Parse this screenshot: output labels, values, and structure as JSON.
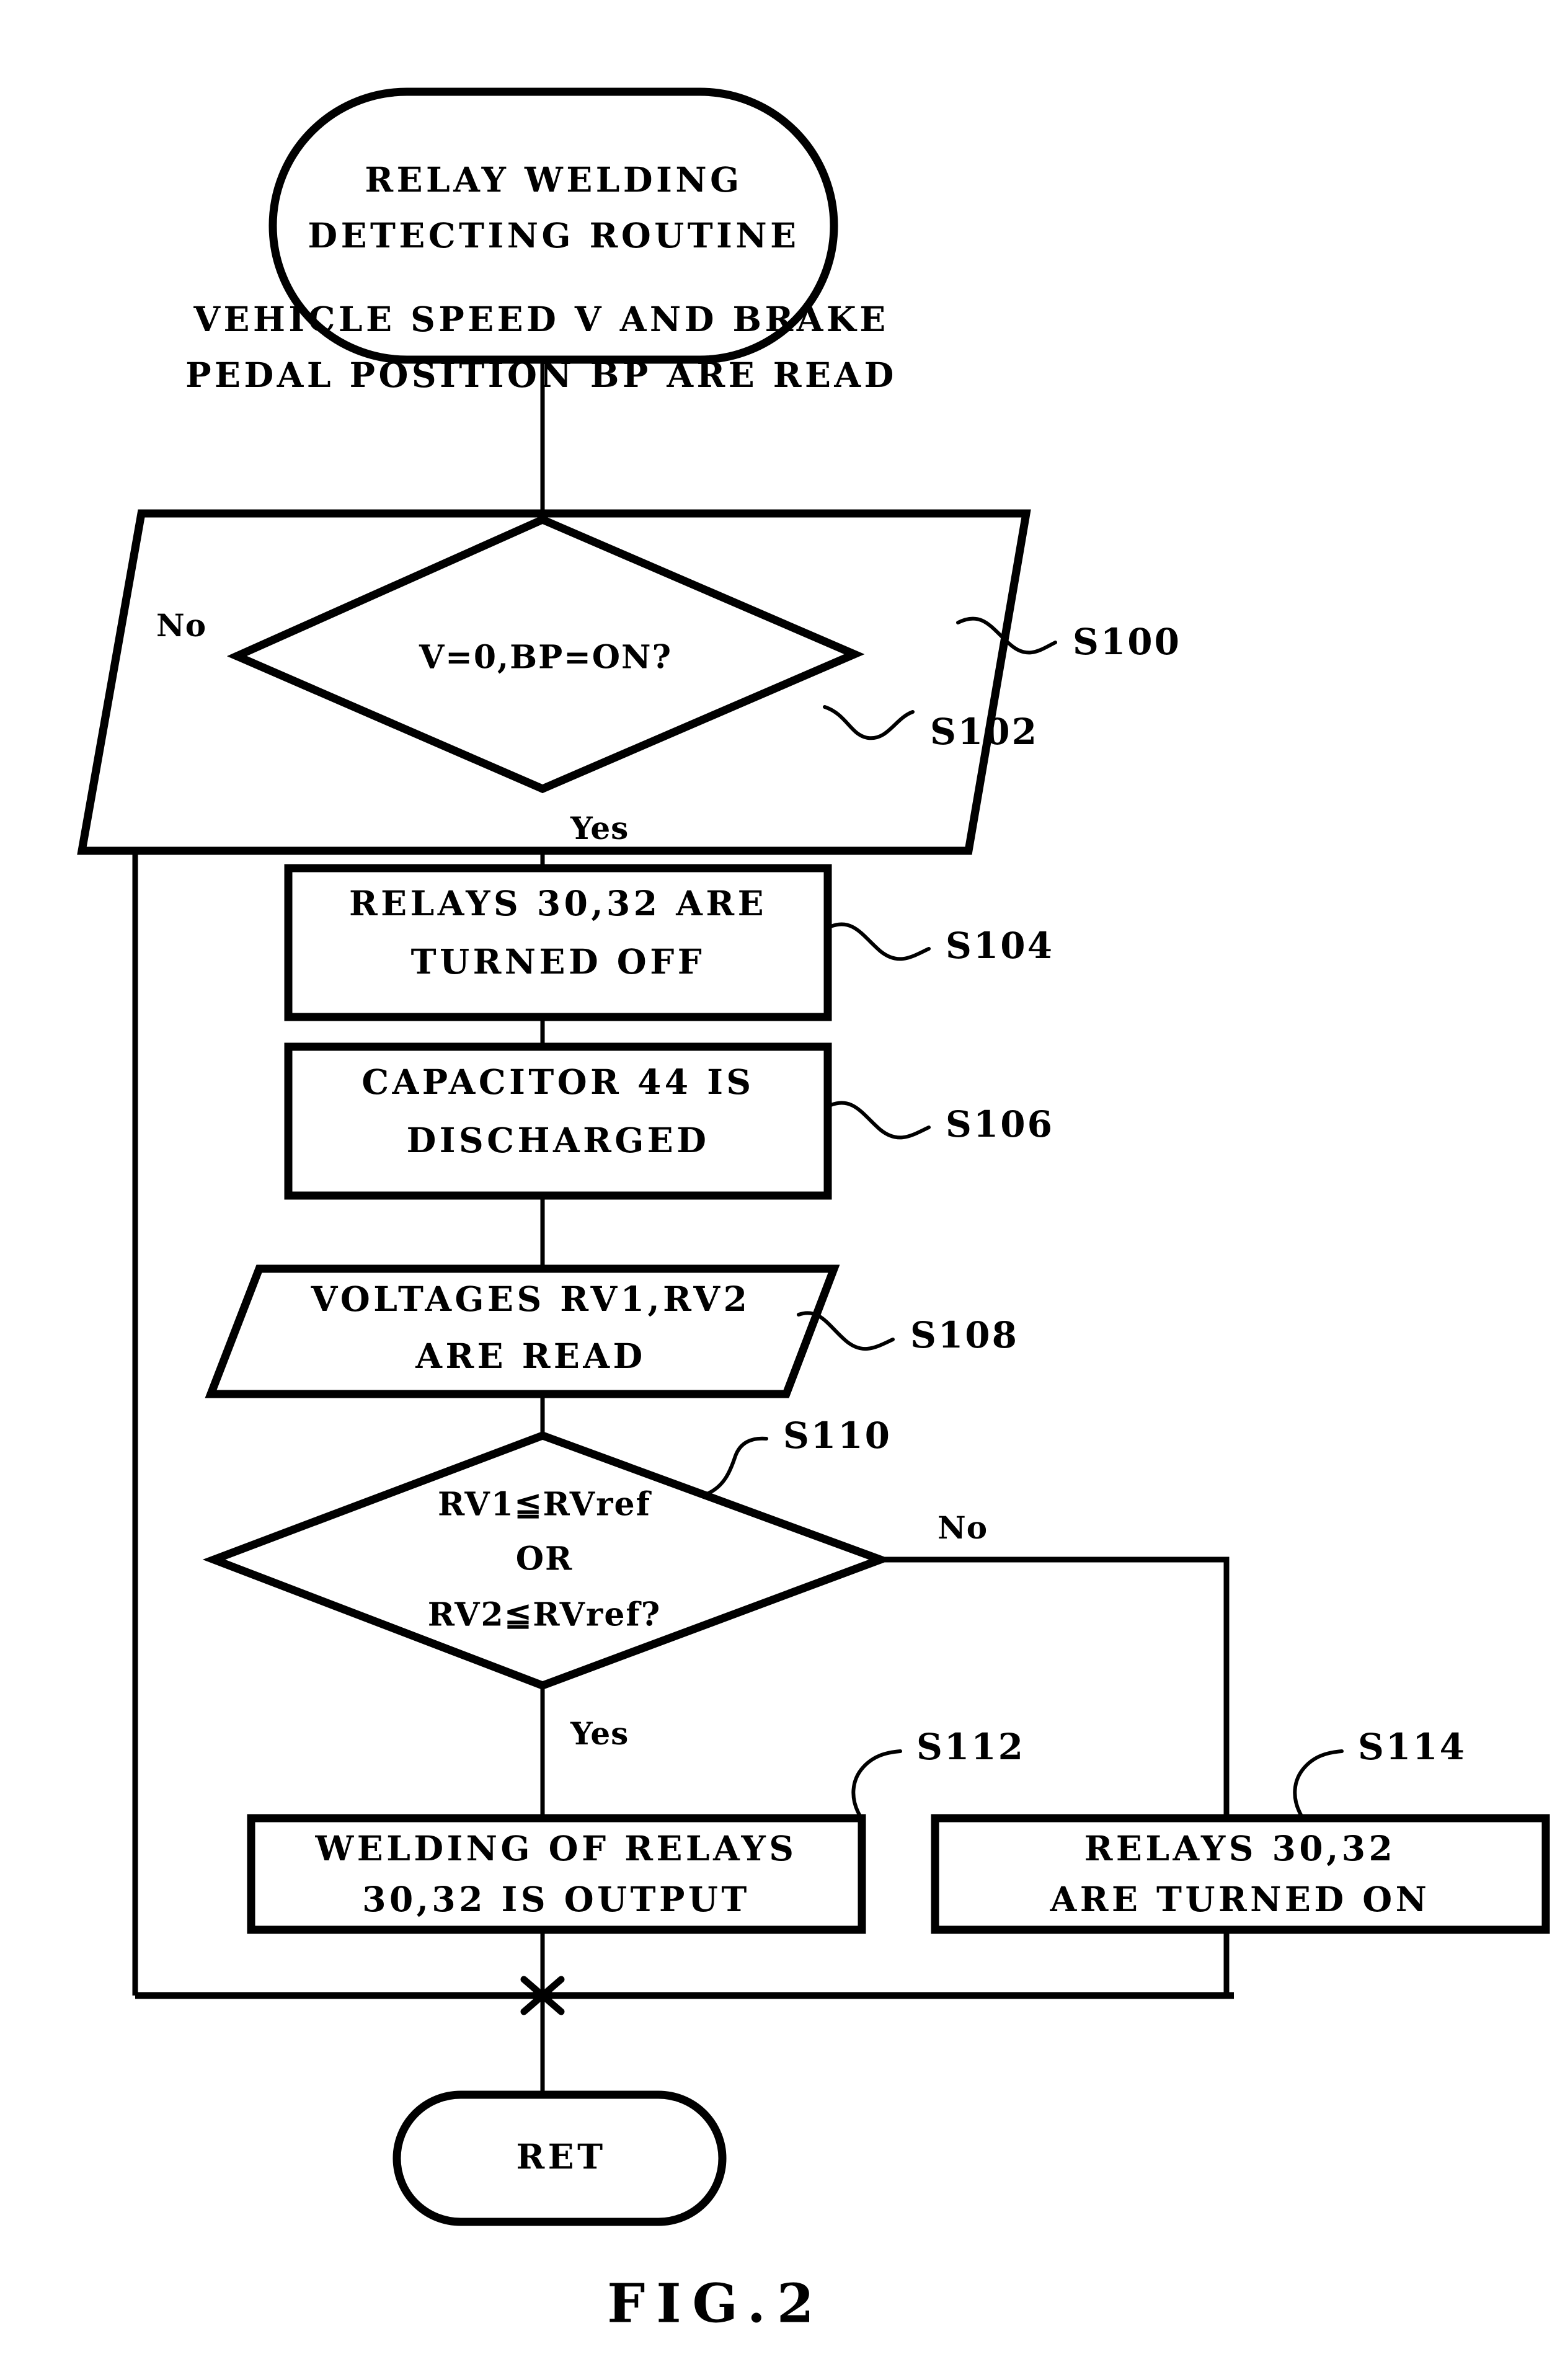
{
  "figure": {
    "caption": "FIG.2",
    "title": "RELAY WELDING DETECTING ROUTINE"
  },
  "nodes": {
    "start": {
      "kind": "terminator",
      "line1": "RELAY WELDING",
      "line2": "DETECTING ROUTINE"
    },
    "s100": {
      "kind": "input-output",
      "step": "S100",
      "line1": "VEHICLE SPEED V AND BRAKE",
      "line2": "PEDAL POSITION BP ARE READ"
    },
    "s102": {
      "kind": "decision",
      "step": "S102",
      "line1": "V=0,BP=ON?",
      "yes": "Yes",
      "no": "No"
    },
    "s104": {
      "kind": "process",
      "step": "S104",
      "line1": "RELAYS 30,32 ARE",
      "line2": "TURNED OFF"
    },
    "s106": {
      "kind": "process",
      "step": "S106",
      "line1": "CAPACITOR 44 IS",
      "line2": "DISCHARGED"
    },
    "s108": {
      "kind": "input-output",
      "step": "S108",
      "line1": "VOLTAGES RV1,RV2",
      "line2": "ARE READ"
    },
    "s110": {
      "kind": "decision",
      "step": "S110",
      "line1": "RV1≦RVref",
      "line2": "OR",
      "line3": "RV2≦RVref?",
      "yes": "Yes",
      "no": "No"
    },
    "s112": {
      "kind": "process",
      "step": "S112",
      "line1": "WELDING OF RELAYS",
      "line2": "30,32 IS OUTPUT"
    },
    "s114": {
      "kind": "process",
      "step": "S114",
      "line1": "RELAYS 30,32",
      "line2": "ARE TURNED ON"
    },
    "end": {
      "kind": "terminator",
      "line1": "RET"
    }
  },
  "colors": {
    "ink": "#000000",
    "paper": "#ffffff"
  }
}
